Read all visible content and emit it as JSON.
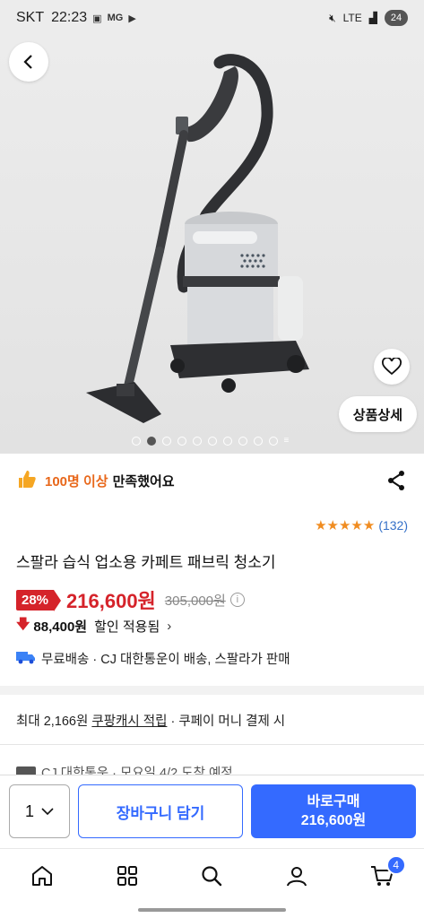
{
  "status_bar": {
    "carrier": "SKT",
    "time": "22:23",
    "icon_label": "MG",
    "network": "LTE",
    "battery": "24"
  },
  "hero": {
    "detail_button": "상품상세",
    "image_count": 10,
    "active_index": 1
  },
  "satisfaction": {
    "highlight": "100명 이상",
    "suffix": "만족했어요"
  },
  "rating": {
    "stars": 5,
    "count": "(132)"
  },
  "product": {
    "title": "스팔라 습식 업소용 카페트 패브릭 청소기",
    "discount": "28%",
    "price": "216,600원",
    "original_price": "305,000원",
    "sale_amount": "88,400원",
    "sale_label": "할인 적용됨",
    "shipping": "무료배송 · CJ 대한통운이 배송, 스팔라가 판매"
  },
  "cash": {
    "prefix": "최대 2,166원",
    "link": "쿠팡캐시 적립",
    "suffix": "· 쿠페이 머니 결제 시"
  },
  "delivery": {
    "text": "CJ 대한통운 · 모요일 4/2 도착 예정"
  },
  "buy_bar": {
    "quantity": "1",
    "cart_label": "장바구니 담기",
    "buy_label": "바로구매",
    "buy_price": "216,600원"
  },
  "bottom_nav": {
    "cart_count": "4"
  },
  "colors": {
    "accent": "#346aff",
    "price_red": "#d5232a",
    "star": "#f08c20"
  }
}
